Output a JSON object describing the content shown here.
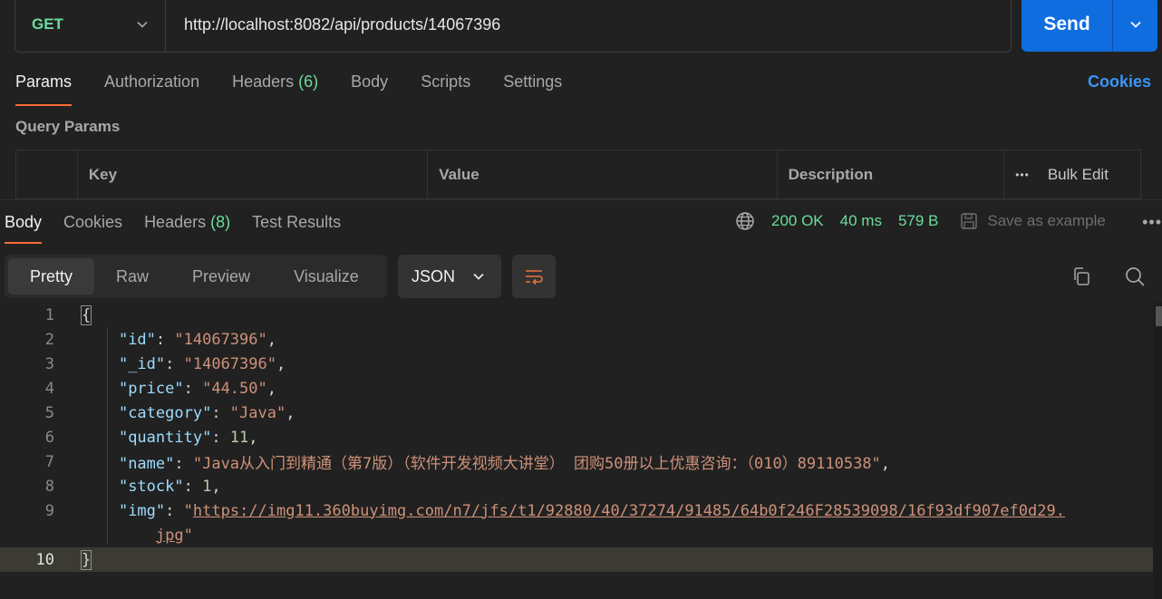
{
  "request": {
    "method": "GET",
    "url": "http://localhost:8082/api/products/14067396",
    "send_label": "Send"
  },
  "req_tabs": {
    "params": "Params",
    "authorization": "Authorization",
    "headers": "Headers",
    "headers_count": "(6)",
    "body": "Body",
    "scripts": "Scripts",
    "settings": "Settings",
    "cookies": "Cookies"
  },
  "query_params": {
    "title": "Query Params",
    "col_key": "Key",
    "col_value": "Value",
    "col_description": "Description",
    "bulk_edit": "Bulk Edit",
    "more_dots": "•••"
  },
  "response": {
    "tabs": {
      "body": "Body",
      "cookies": "Cookies",
      "headers": "Headers",
      "headers_count": "(8)",
      "test_results": "Test Results"
    },
    "status": "200 OK",
    "time": "40 ms",
    "size": "579 B",
    "save_example": "Save as example",
    "more_dots": "•••",
    "views": {
      "pretty": "Pretty",
      "raw": "Raw",
      "preview": "Preview",
      "visualize": "Visualize"
    },
    "format": "JSON"
  },
  "code_lines": {
    "n1": "1",
    "n2": "2",
    "n3": "3",
    "n4": "4",
    "n5": "5",
    "n6": "6",
    "n7": "7",
    "n8": "8",
    "n9": "9",
    "n10": "10",
    "open_brace": "{",
    "close_brace": "}",
    "id_key": "\"id\"",
    "id_val": "\"14067396\"",
    "_id_key": "\"_id\"",
    "_id_val": "\"14067396\"",
    "price_key": "\"price\"",
    "price_val": "\"44.50\"",
    "category_key": "\"category\"",
    "category_val": "\"Java\"",
    "quantity_key": "\"quantity\"",
    "quantity_val": "11",
    "name_key": "\"name\"",
    "name_val": "\"Java从入门到精通（第7版）（软件开发视频大讲堂） 团购50册以上优惠咨询：（010）89110538\"",
    "stock_key": "\"stock\"",
    "stock_val": "1",
    "img_key": "\"img\"",
    "img_val_line1": "https://img11.360buyimg.com/n7/jfs/t1/92880/40/37274/91485/64b0f246F28539098/16f93df907ef0d29.",
    "img_val_line2": "jpg"
  }
}
